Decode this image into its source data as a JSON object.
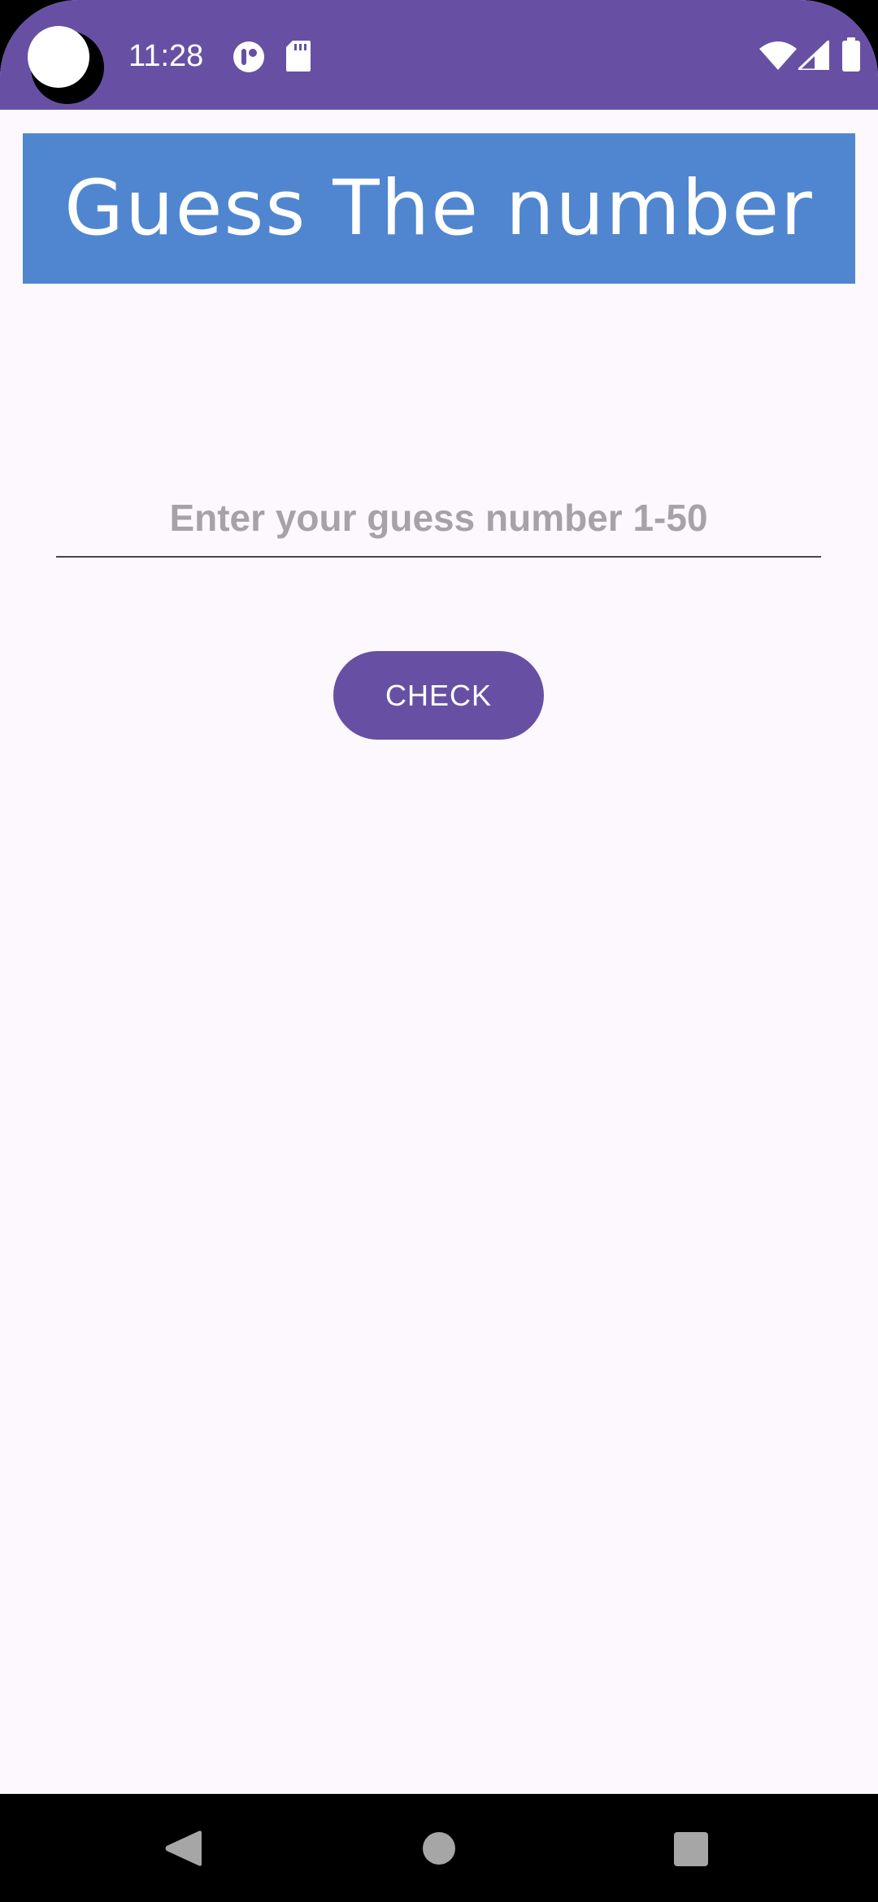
{
  "status_bar": {
    "time": "11:28",
    "background": "#6750a4",
    "icons": [
      "camera-cutout-icon",
      "app-notification-icon",
      "sd-card-icon",
      "wifi-icon",
      "cellular-signal-icon",
      "battery-icon"
    ]
  },
  "header": {
    "title": "Guess The number",
    "background": "#5086cf"
  },
  "form": {
    "guess_input_value": "",
    "guess_input_placeholder": "Enter your guess number 1-50",
    "check_label": "CHECK",
    "accent": "#6750a4"
  },
  "nav_bar": {
    "icons": [
      "back-icon",
      "home-icon",
      "recents-icon"
    ]
  }
}
